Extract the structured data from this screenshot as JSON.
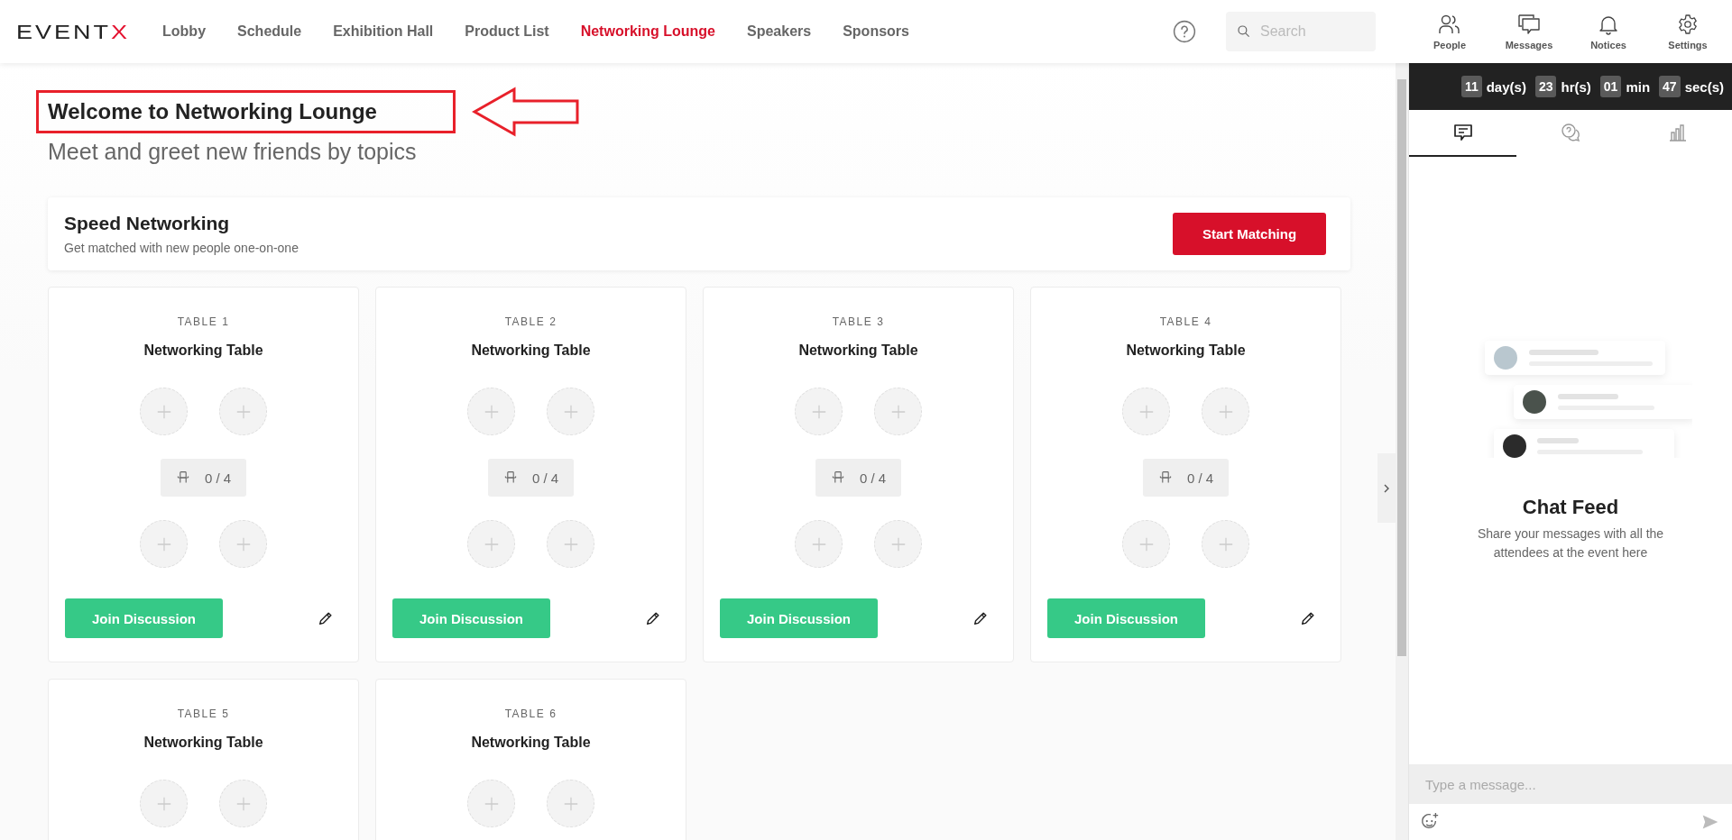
{
  "nav": {
    "logo": {
      "text": "EVENT",
      "accent": "X"
    },
    "items": [
      {
        "label": "Lobby",
        "selected": false
      },
      {
        "label": "Schedule",
        "selected": false
      },
      {
        "label": "Exhibition Hall",
        "selected": false
      },
      {
        "label": "Product List",
        "selected": false
      },
      {
        "label": "Networking Lounge",
        "selected": true
      },
      {
        "label": "Speakers",
        "selected": false
      },
      {
        "label": "Sponsors",
        "selected": false
      }
    ],
    "search": {
      "placeholder": "Search"
    },
    "actions": [
      {
        "kind": "people",
        "label": "People"
      },
      {
        "kind": "messages",
        "label": "Messages"
      },
      {
        "kind": "notices",
        "label": "Notices"
      },
      {
        "kind": "settings",
        "label": "Settings"
      }
    ]
  },
  "page": {
    "title": "Welcome to Networking Lounge",
    "subtitle": "Meet and greet new friends by topics"
  },
  "speed_networking": {
    "title": "Speed Networking",
    "description": "Get matched with new people one-on-one",
    "button": "Start Matching"
  },
  "tables": [
    {
      "label": "TABLE 1",
      "name": "Networking Table",
      "occupancy": "0 / 4",
      "button": "Join Discussion"
    },
    {
      "label": "TABLE 2",
      "name": "Networking Table",
      "occupancy": "0 / 4",
      "button": "Join Discussion"
    },
    {
      "label": "TABLE 3",
      "name": "Networking Table",
      "occupancy": "0 / 4",
      "button": "Join Discussion"
    },
    {
      "label": "TABLE 4",
      "name": "Networking Table",
      "occupancy": "0 / 4",
      "button": "Join Discussion"
    },
    {
      "label": "TABLE 5",
      "name": "Networking Table"
    },
    {
      "label": "TABLE 6",
      "name": "Networking Table"
    }
  ],
  "countdown": [
    {
      "value": "11",
      "unit": "day(s)"
    },
    {
      "value": "23",
      "unit": "hr(s)"
    },
    {
      "value": "01",
      "unit": "min"
    },
    {
      "value": "47",
      "unit": "sec(s)"
    }
  ],
  "panel_tabs": [
    {
      "kind": "chat",
      "selected": true
    },
    {
      "kind": "qa",
      "selected": false
    },
    {
      "kind": "poll",
      "selected": false
    }
  ],
  "chat_feed": {
    "title": "Chat Feed",
    "description": "Share your messages with all the attendees at the event here"
  },
  "composer": {
    "placeholder": "Type a message..."
  }
}
